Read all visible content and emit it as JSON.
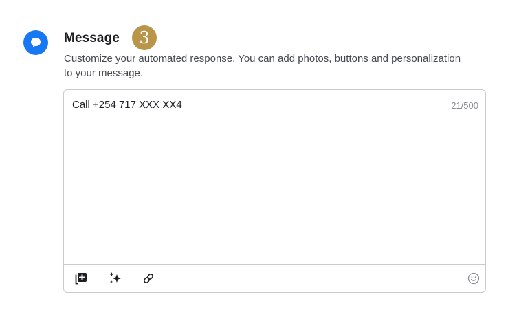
{
  "section": {
    "title": "Message",
    "step_number": "3",
    "description": "Customize your automated response. You can add photos, buttons and personalization to your message."
  },
  "editor": {
    "value": "Call +254 717 XXX XX4",
    "char_count": "21/500"
  },
  "toolbar": {
    "icons": [
      "add-photo-icon",
      "sparkle-icon",
      "link-icon",
      "emoji-icon"
    ]
  },
  "colors": {
    "accent": "#1877f2",
    "step_badge": "#b9954a",
    "border": "#c8ccd1",
    "muted_text": "#8a8d91"
  }
}
